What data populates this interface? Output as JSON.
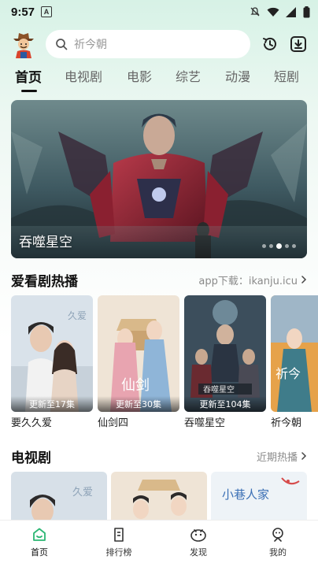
{
  "status_bar": {
    "time": "9:57",
    "notification_letter": "A"
  },
  "search": {
    "placeholder": "祈今朝"
  },
  "tabs": [
    {
      "label": "首页",
      "active": true
    },
    {
      "label": "电视剧"
    },
    {
      "label": "电影"
    },
    {
      "label": "综艺"
    },
    {
      "label": "动漫"
    },
    {
      "label": "短剧"
    }
  ],
  "banner": {
    "title": "吞噬星空",
    "slide_count": 5,
    "active_slide": 3
  },
  "hot_section": {
    "title": "爱看剧热播",
    "link": "app下载：ikanju.icu",
    "items": [
      {
        "title": "要久久爱",
        "badge": "更新至17集"
      },
      {
        "title": "仙剑四",
        "badge": "更新至30集"
      },
      {
        "title": "吞噬星空",
        "badge": "更新至104集"
      },
      {
        "title": "祈今朝",
        "badge": ""
      }
    ]
  },
  "tv_section": {
    "title": "电视剧",
    "link": "近期热播"
  },
  "bottom_nav": [
    {
      "label": "首页",
      "icon": "home-icon",
      "active": true
    },
    {
      "label": "排行榜",
      "icon": "ranking-icon"
    },
    {
      "label": "发现",
      "icon": "discover-icon"
    },
    {
      "label": "我的",
      "icon": "profile-icon"
    }
  ],
  "colors": {
    "accent": "#2bb673",
    "background_top": "#d7f2e6"
  }
}
